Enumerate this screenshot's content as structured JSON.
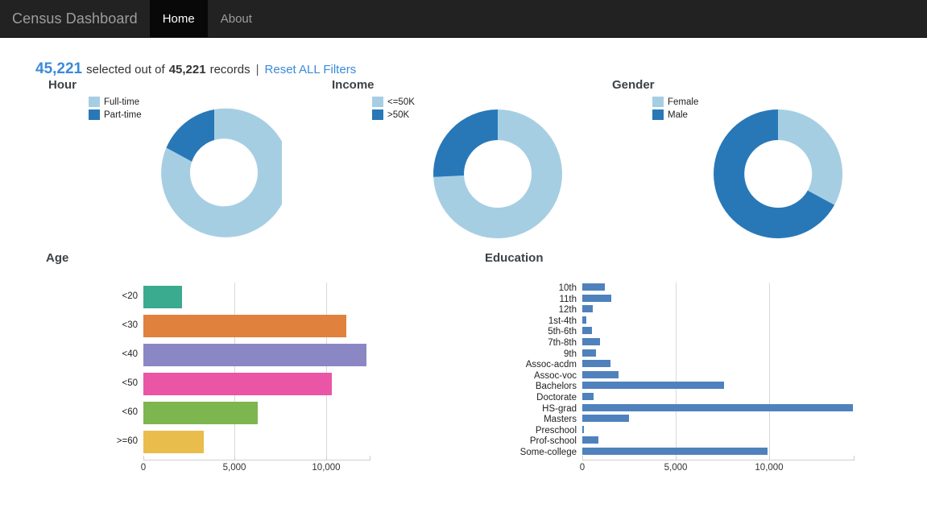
{
  "navbar": {
    "brand": "Census Dashboard",
    "items": [
      {
        "label": "Home",
        "active": true
      },
      {
        "label": "About",
        "active": false
      }
    ]
  },
  "status": {
    "selected": "45,221",
    "middle_text": "selected out of",
    "total": "45,221",
    "records_text": "records",
    "separator": "|",
    "reset_label": "Reset ALL Filters"
  },
  "colors": {
    "light_blue": "#a6cee3",
    "dark_blue": "#2878b8",
    "education_bar": "#4f81bd",
    "link": "#3b8ad9",
    "navbar_bg": "#222222",
    "title": "#3c4247"
  },
  "chart_data": [
    {
      "type": "pie",
      "title": "Hour",
      "labels": [
        "Full-time",
        "Part-time"
      ],
      "values": [
        39200,
        6021
      ],
      "percents": [
        86.7,
        13.3
      ],
      "colors": [
        "#a6cee3",
        "#2878b8"
      ],
      "legend": "top-left",
      "donut": true
    },
    {
      "type": "pie",
      "title": "Income",
      "labels": [
        "<=50K",
        ">50K"
      ],
      "values": [
        34014,
        11207
      ],
      "percents": [
        75.2,
        24.8
      ],
      "colors": [
        "#a6cee3",
        "#2878b8"
      ],
      "legend": "top-left",
      "donut": true
    },
    {
      "type": "pie",
      "title": "Gender",
      "labels": [
        "Female",
        "Male"
      ],
      "values": [
        14920,
        30301
      ],
      "percents": [
        33.0,
        67.0
      ],
      "colors": [
        "#a6cee3",
        "#2878b8"
      ],
      "legend": "top-left",
      "donut": true
    },
    {
      "type": "bar",
      "orientation": "horizontal",
      "title": "Age",
      "categories": [
        "<20",
        "<30",
        "<40",
        "<50",
        "<60",
        ">=60"
      ],
      "values": [
        2100,
        11100,
        12200,
        10300,
        6250,
        3300
      ],
      "colors": [
        "#3aab8e",
        "#e0813d",
        "#8b87c4",
        "#ea55a6",
        "#7db54f",
        "#e9bd4c"
      ],
      "xticks": [
        0,
        5000,
        10000
      ],
      "xtick_labels": [
        "0",
        "5,000",
        "10,000"
      ],
      "xlim": [
        0,
        12430
      ],
      "grid": true,
      "ylabel": "",
      "xlabel": ""
    },
    {
      "type": "bar",
      "orientation": "horizontal",
      "title": "Education",
      "categories": [
        "10th",
        "11th",
        "12th",
        "1st-4th",
        "5th-6th",
        "7th-8th",
        "9th",
        "Assoc-acdm",
        "Assoc-voc",
        "Bachelors",
        "Doctorate",
        "HS-grad",
        "Masters",
        "Preschool",
        "Prof-school",
        "Some-college"
      ],
      "values": [
        1200,
        1550,
        550,
        230,
        500,
        950,
        750,
        1500,
        1950,
        7550,
        600,
        14450,
        2500,
        80,
        850,
        9900
      ],
      "colors": [
        "#4f81bd"
      ],
      "xticks": [
        0,
        5000,
        10000
      ],
      "xtick_labels": [
        "0",
        "5,000",
        "10,000"
      ],
      "xlim": [
        0,
        14560
      ],
      "grid": true,
      "ylabel": "",
      "xlabel": ""
    }
  ]
}
